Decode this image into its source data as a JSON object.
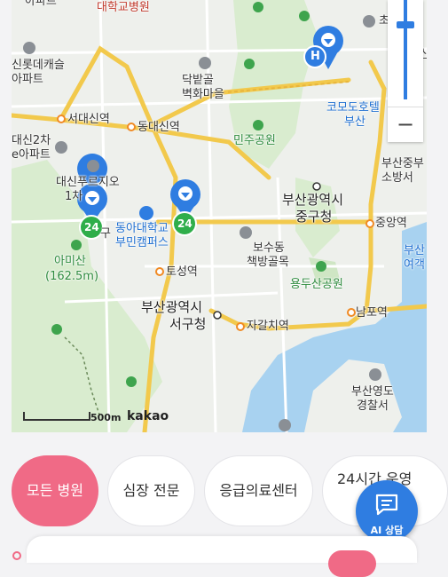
{
  "map": {
    "labels": {
      "daehakgyo": "대학교병원",
      "apart_top": "아파트",
      "lotte": "신롯데캐슬",
      "lotte_apt": "아파트",
      "seodaesin": "서대신역",
      "dongdaesin": "동대신역",
      "daesin2": "대신2차",
      "daesin2_apt": "e아파트",
      "daesin_prugio": "대신푸르지오",
      "daesin_prugio_2": "1차",
      "dakbat": "닥밭골",
      "dakbat_2": "벽화마을",
      "minju": "민주공원",
      "commodore": "코모도호텔",
      "commodore_2": "부산",
      "busan_junggu_fire": "부산중부",
      "busan_junggu_fire_2": "소방서",
      "junggu_office": "부산광역시",
      "junggu_office_2": "중구청",
      "jungang": "중앙역",
      "donga": "동아대학교",
      "donga_2": "부민캠퍼스",
      "amisan": "아미산",
      "amisan_2": "(162.5m)",
      "bosu": "보수동",
      "bosu_2": "책방골목",
      "toseong": "토성역",
      "yongdusan": "용두산공원",
      "seogu_office": "부산광역시",
      "seogu_office_2": "서구청",
      "jagalchi": "자갈치역",
      "nampo": "남포역",
      "yeongdo_police": "부산영도",
      "yeongdo_police_2": "경찰서",
      "busan_port": "부산",
      "busan_port_2": "여객",
      "gu_label": "구",
      "cho": "초",
      "sin": "산"
    },
    "markers": {
      "pin_24_left": "24",
      "pin_24_mid": "24",
      "hospital_h": "H"
    },
    "scale_label": "500m",
    "brand": "kakao",
    "zoom_out": "−"
  },
  "filters": [
    {
      "label": "모든 병원",
      "active": true
    },
    {
      "label": "심장 전문",
      "active": false
    },
    {
      "label": "응급의료센터",
      "active": false
    },
    {
      "label": "24시간 운영",
      "active": false
    }
  ],
  "ai_button": {
    "label": "AI 상담"
  },
  "colors": {
    "accent_pink": "#f06a86",
    "accent_blue": "#2f7de1",
    "marker_green": "#2fae4a"
  }
}
